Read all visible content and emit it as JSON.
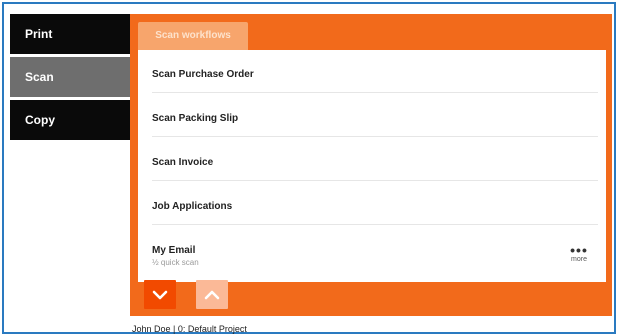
{
  "nav": {
    "items": [
      {
        "label": "Print",
        "active": false
      },
      {
        "label": "Scan",
        "active": true
      },
      {
        "label": "Copy",
        "active": false
      }
    ]
  },
  "panel": {
    "tab_label": "Scan workflows",
    "rows": [
      {
        "label": "Scan Purchase Order",
        "sub": ""
      },
      {
        "label": "Scan Packing Slip",
        "sub": ""
      },
      {
        "label": "Scan Invoice",
        "sub": ""
      },
      {
        "label": "Job Applications",
        "sub": ""
      },
      {
        "label": "My Email",
        "sub": "½ quick scan"
      }
    ],
    "more": {
      "dots": "•••",
      "label": "more",
      "icon": "ellipsis-icon"
    },
    "buttons": {
      "down_icon": "chevron-down-icon",
      "up_icon": "chevron-up-icon"
    }
  },
  "footer": {
    "text": "John Doe | 0: Default Project"
  },
  "colors": {
    "accent": "#f26a1b",
    "tab": "#f7a56c",
    "button_down": "#f24a00",
    "button_up": "#fbb997",
    "nav_bg": "#0a0a0a",
    "nav_active": "#6e6e6e",
    "border": "#2a7ac0"
  }
}
